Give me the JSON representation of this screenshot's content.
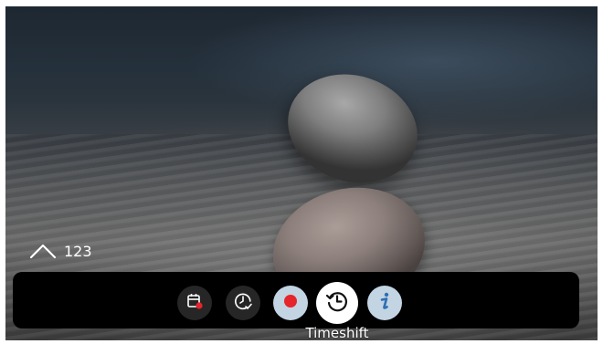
{
  "channel": {
    "number": "123",
    "up_icon": "chevron-up-icon"
  },
  "controls": {
    "buttons": [
      {
        "name": "schedule-recording-button",
        "icon": "calendar-record-icon",
        "style": "dark"
      },
      {
        "name": "watch-reminder-button",
        "icon": "clock-check-icon",
        "style": "dark"
      },
      {
        "name": "record-button",
        "icon": "record-dot-icon",
        "style": "light"
      },
      {
        "name": "timeshift-button",
        "icon": "timeshift-icon",
        "style": "selected"
      },
      {
        "name": "info-button",
        "icon": "info-icon",
        "style": "light"
      }
    ],
    "focused_label": "Timeshift"
  },
  "colors": {
    "record_red": "#e5242b",
    "accent_blue": "#2f6fb3",
    "light_button": "#c3d4e3",
    "bar": "#000000"
  }
}
